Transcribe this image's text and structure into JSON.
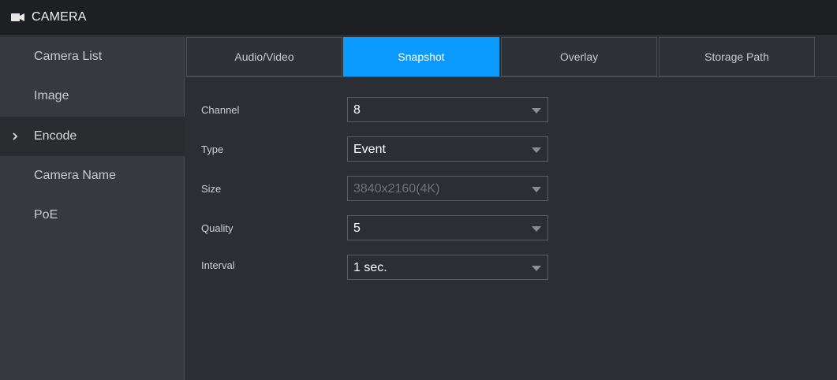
{
  "header": {
    "title": "CAMERA",
    "icon": "camera-icon"
  },
  "sidebar": {
    "items": [
      {
        "label": "Camera List"
      },
      {
        "label": "Image"
      },
      {
        "label": "Encode"
      },
      {
        "label": "Camera Name"
      },
      {
        "label": "PoE"
      }
    ],
    "active": "Encode"
  },
  "tabs": [
    {
      "label": "Audio/Video"
    },
    {
      "label": "Snapshot"
    },
    {
      "label": "Overlay"
    },
    {
      "label": "Storage Path"
    }
  ],
  "active_tab": "Snapshot",
  "form": {
    "channel": {
      "label": "Channel",
      "value": "8"
    },
    "type": {
      "label": "Type",
      "value": "Event"
    },
    "size": {
      "label": "Size",
      "value": "3840x2160(4K)",
      "disabled": true
    },
    "quality": {
      "label": "Quality",
      "value": "5"
    },
    "interval": {
      "label": "Interval",
      "value": "1 sec."
    }
  },
  "colors": {
    "accent": "#0b9bff",
    "titlebar": "#1d1f22",
    "sidebar": "#36393f",
    "content": "#2b2e33"
  }
}
